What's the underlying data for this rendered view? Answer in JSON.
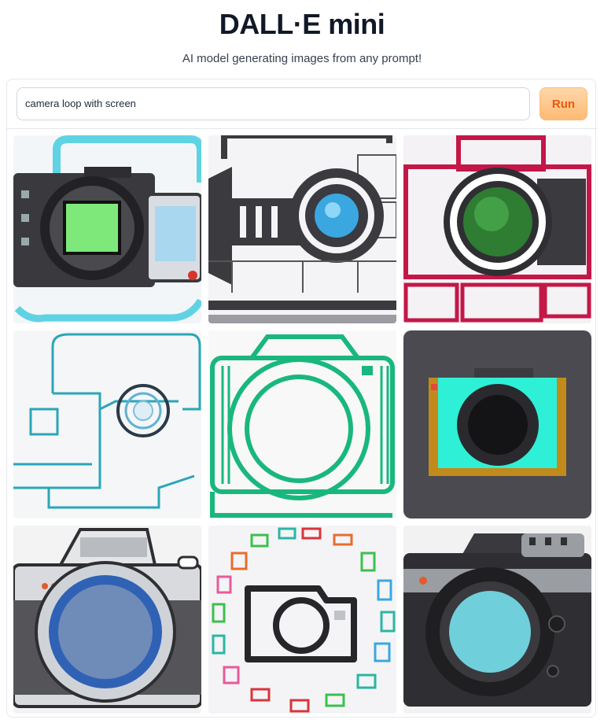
{
  "app": {
    "title": "DALL·E mini",
    "subtitle": "AI model generating images from any prompt!"
  },
  "prompt": {
    "value": "camera loop with screen"
  },
  "run_button": {
    "label": "Run",
    "color": "#fdba74"
  },
  "gallery": {
    "images": [
      {
        "description_icon": "camera-screen-image"
      },
      {
        "description_icon": "camera-lens-sketch-image"
      },
      {
        "description_icon": "red-camera-image"
      },
      {
        "description_icon": "teal-line-camera-image"
      },
      {
        "description_icon": "green-line-camera-image"
      },
      {
        "description_icon": "cyan-camera-image"
      },
      {
        "description_icon": "silver-camera-image"
      },
      {
        "description_icon": "camera-circle-loop-image"
      },
      {
        "description_icon": "dark-camera-image"
      }
    ]
  }
}
